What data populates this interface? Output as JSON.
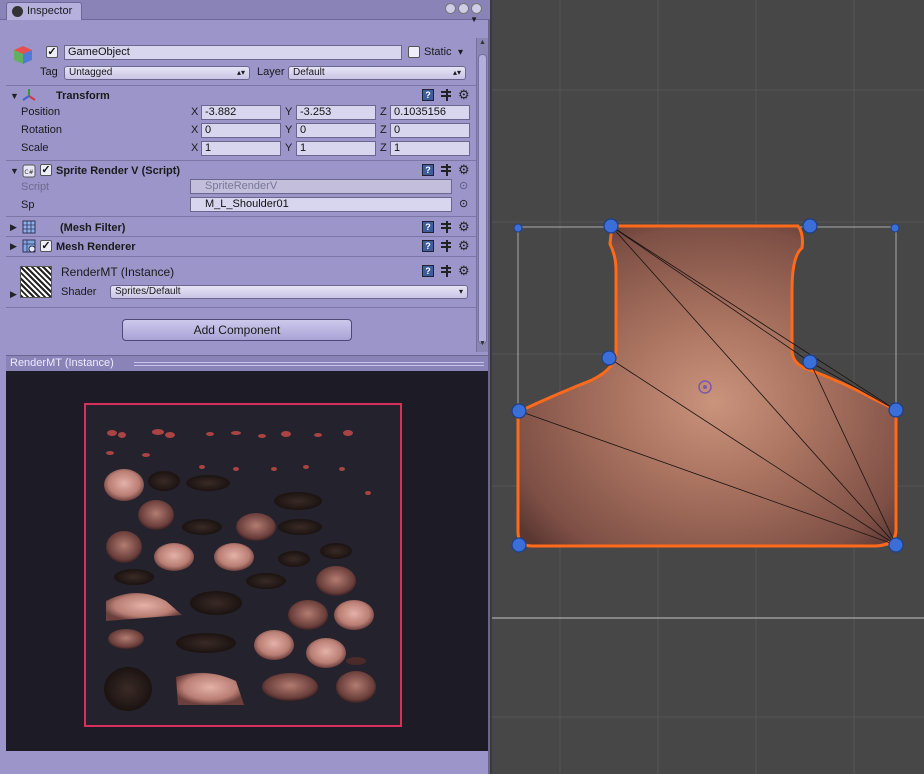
{
  "tab": {
    "label": "Inspector",
    "info_glyph": "i"
  },
  "gameobject": {
    "active": true,
    "name": "GameObject",
    "static_label": "Static",
    "static": false,
    "tag_label": "Tag",
    "tag_value": "Untagged",
    "layer_label": "Layer",
    "layer_value": "Default"
  },
  "transform": {
    "title": "Transform",
    "rows": [
      {
        "label": "Position",
        "x": "-3.882",
        "y": "-3.253",
        "z": "0.1035156"
      },
      {
        "label": "Rotation",
        "x": "0",
        "y": "0",
        "z": "0"
      },
      {
        "label": "Scale",
        "x": "1",
        "y": "1",
        "z": "1"
      }
    ],
    "axis": {
      "x": "X",
      "y": "Y",
      "z": "Z"
    }
  },
  "sprite_render": {
    "title": "Sprite Render V (Script)",
    "enabled": true,
    "script_label": "Script",
    "script_value": "SpriteRenderV",
    "sp_label": "Sp",
    "sp_value": "M_L_Shoulder01"
  },
  "mesh_filter": {
    "title": "(Mesh Filter)"
  },
  "mesh_renderer": {
    "title": "Mesh Renderer",
    "enabled": true
  },
  "material": {
    "title": "RenderMT (Instance)",
    "shader_label": "Shader",
    "shader_value": "Sprites/Default"
  },
  "add_component_label": "Add Component",
  "preview": {
    "title": "RenderMT (Instance)"
  },
  "icons": {
    "help": "?",
    "gear": "⚙",
    "dropdown_arrow": "▾",
    "fold_open": "▼",
    "fold_closed": "▶",
    "check": "✓",
    "scroll_up": "▲",
    "scroll_down": "▼",
    "tab_menu": "▼",
    "target": "⊙"
  },
  "colors": {
    "inspector_bg": "#9c95c9",
    "atlas_border": "#d8305c",
    "sprite_outline": "#ff6a1a",
    "handle": "#3b6fd8",
    "scene_bg": "#474747"
  }
}
